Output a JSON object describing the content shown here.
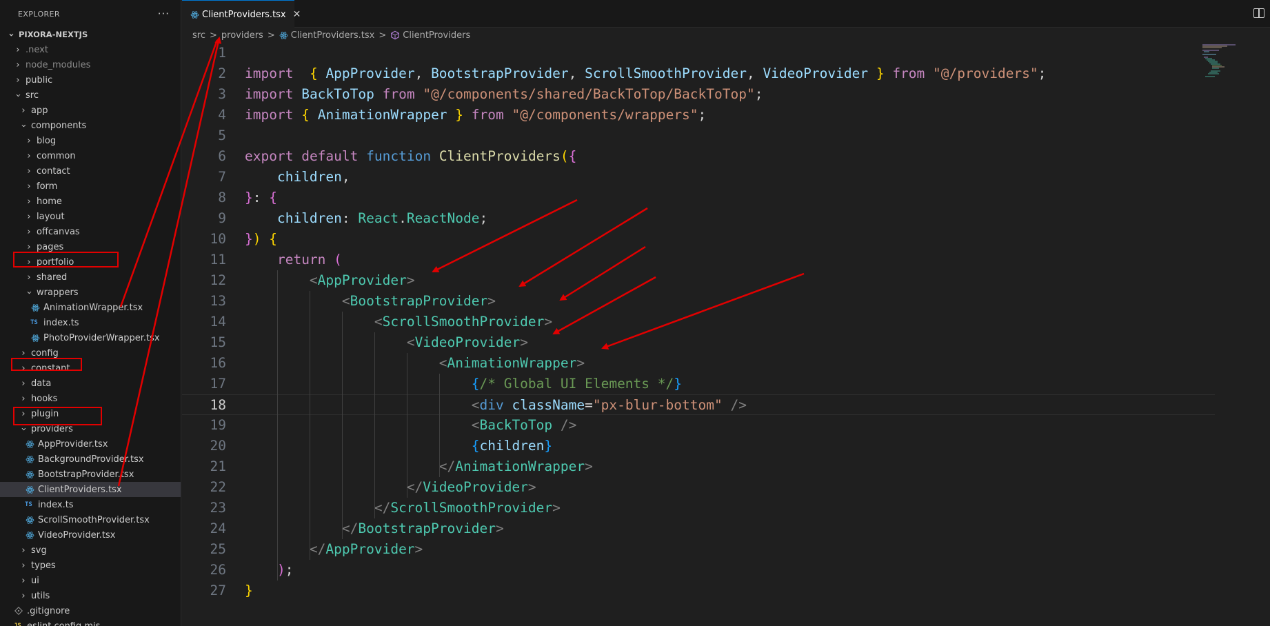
{
  "explorer": {
    "title": "EXPLORER",
    "more": "···",
    "project": "PIXORA-NEXTJS",
    "tree": [
      {
        "label": ".next",
        "depth": 1,
        "kind": "folder",
        "open": false,
        "dim": true
      },
      {
        "label": "node_modules",
        "depth": 1,
        "kind": "folder",
        "open": false,
        "dim": true
      },
      {
        "label": "public",
        "depth": 1,
        "kind": "folder",
        "open": false
      },
      {
        "label": "src",
        "depth": 1,
        "kind": "folder",
        "open": true
      },
      {
        "label": "app",
        "depth": 2,
        "kind": "folder",
        "open": false
      },
      {
        "label": "components",
        "depth": 2,
        "kind": "folder",
        "open": true
      },
      {
        "label": "blog",
        "depth": 3,
        "kind": "folder",
        "open": false
      },
      {
        "label": "common",
        "depth": 3,
        "kind": "folder",
        "open": false
      },
      {
        "label": "contact",
        "depth": 3,
        "kind": "folder",
        "open": false
      },
      {
        "label": "form",
        "depth": 3,
        "kind": "folder",
        "open": false
      },
      {
        "label": "home",
        "depth": 3,
        "kind": "folder",
        "open": false
      },
      {
        "label": "layout",
        "depth": 3,
        "kind": "folder",
        "open": false
      },
      {
        "label": "offcanvas",
        "depth": 3,
        "kind": "folder",
        "open": false
      },
      {
        "label": "pages",
        "depth": 3,
        "kind": "folder",
        "open": false
      },
      {
        "label": "portfolio",
        "depth": 3,
        "kind": "folder",
        "open": false
      },
      {
        "label": "shared",
        "depth": 3,
        "kind": "folder",
        "open": false
      },
      {
        "label": "wrappers",
        "depth": 3,
        "kind": "folder",
        "open": true
      },
      {
        "label": "AnimationWrapper.tsx",
        "depth": 4,
        "kind": "react"
      },
      {
        "label": "index.ts",
        "depth": 4,
        "kind": "ts"
      },
      {
        "label": "PhotoProviderWrapper.tsx",
        "depth": 4,
        "kind": "react"
      },
      {
        "label": "config",
        "depth": 2,
        "kind": "folder",
        "open": false
      },
      {
        "label": "constant",
        "depth": 2,
        "kind": "folder",
        "open": false
      },
      {
        "label": "data",
        "depth": 2,
        "kind": "folder",
        "open": false
      },
      {
        "label": "hooks",
        "depth": 2,
        "kind": "folder",
        "open": false
      },
      {
        "label": "plugin",
        "depth": 2,
        "kind": "folder",
        "open": false
      },
      {
        "label": "providers",
        "depth": 2,
        "kind": "folder",
        "open": true
      },
      {
        "label": "AppProvider.tsx",
        "depth": 3,
        "kind": "react"
      },
      {
        "label": "BackgroundProvider.tsx",
        "depth": 3,
        "kind": "react"
      },
      {
        "label": "BootstrapProvider.tsx",
        "depth": 3,
        "kind": "react"
      },
      {
        "label": "ClientProviders.tsx",
        "depth": 3,
        "kind": "react",
        "selected": true
      },
      {
        "label": "index.ts",
        "depth": 3,
        "kind": "ts"
      },
      {
        "label": "ScrollSmoothProvider.tsx",
        "depth": 3,
        "kind": "react"
      },
      {
        "label": "VideoProvider.tsx",
        "depth": 3,
        "kind": "react"
      },
      {
        "label": "svg",
        "depth": 2,
        "kind": "folder",
        "open": false
      },
      {
        "label": "types",
        "depth": 2,
        "kind": "folder",
        "open": false
      },
      {
        "label": "ui",
        "depth": 2,
        "kind": "folder",
        "open": false
      },
      {
        "label": "utils",
        "depth": 2,
        "kind": "folder",
        "open": false
      },
      {
        "label": ".gitignore",
        "depth": 1,
        "kind": "git"
      },
      {
        "label": "eslint.config.mjs",
        "depth": 1,
        "kind": "js"
      }
    ]
  },
  "tab": {
    "label": "ClientProviders.tsx",
    "close": "✕"
  },
  "breadcrumb": {
    "parts": [
      "src",
      "providers",
      "ClientProviders.tsx",
      "ClientProviders"
    ],
    "sep": ">"
  },
  "editor": {
    "current_line": 18,
    "lines": [
      [],
      [
        [
          "kw",
          "import"
        ],
        [
          "",
          "  "
        ],
        [
          "b1",
          "{"
        ],
        [
          "",
          " "
        ],
        [
          "var",
          "AppProvider"
        ],
        [
          "",
          ", "
        ],
        [
          "var",
          "BootstrapProvider"
        ],
        [
          "",
          ", "
        ],
        [
          "var",
          "ScrollSmoothProvider"
        ],
        [
          "",
          ", "
        ],
        [
          "var",
          "VideoProvider"
        ],
        [
          "",
          " "
        ],
        [
          "b1",
          "}"
        ],
        [
          "",
          " "
        ],
        [
          "kw",
          "from"
        ],
        [
          "",
          " "
        ],
        [
          "str",
          "\"@/providers\""
        ],
        [
          "",
          ";"
        ]
      ],
      [
        [
          "kw",
          "import"
        ],
        [
          "",
          " "
        ],
        [
          "var",
          "BackToTop"
        ],
        [
          "",
          " "
        ],
        [
          "kw",
          "from"
        ],
        [
          "",
          " "
        ],
        [
          "str",
          "\"@/components/shared/BackToTop/BackToTop\""
        ],
        [
          "",
          ";"
        ]
      ],
      [
        [
          "kw",
          "import"
        ],
        [
          "",
          " "
        ],
        [
          "b1",
          "{"
        ],
        [
          "",
          " "
        ],
        [
          "var",
          "AnimationWrapper"
        ],
        [
          "",
          " "
        ],
        [
          "b1",
          "}"
        ],
        [
          "",
          " "
        ],
        [
          "kw",
          "from"
        ],
        [
          "",
          " "
        ],
        [
          "str",
          "\"@/components/wrappers\""
        ],
        [
          "",
          ";"
        ]
      ],
      [],
      [
        [
          "kw",
          "export"
        ],
        [
          "",
          " "
        ],
        [
          "kw",
          "default"
        ],
        [
          "",
          " "
        ],
        [
          "kw2",
          "function"
        ],
        [
          "",
          " "
        ],
        [
          "fn",
          "ClientProviders"
        ],
        [
          "b1",
          "("
        ],
        [
          "b2",
          "{"
        ]
      ],
      [
        [
          "",
          "    "
        ],
        [
          "var",
          "children"
        ],
        [
          "",
          ","
        ]
      ],
      [
        [
          "b2",
          "}"
        ],
        [
          "",
          ": "
        ],
        [
          "b2",
          "{"
        ]
      ],
      [
        [
          "",
          "    "
        ],
        [
          "var",
          "children"
        ],
        [
          "",
          ": "
        ],
        [
          "type",
          "React"
        ],
        [
          "",
          "."
        ],
        [
          "type",
          "ReactNode"
        ],
        [
          "",
          ";"
        ]
      ],
      [
        [
          "b2",
          "}"
        ],
        [
          "b1",
          ")"
        ],
        [
          "",
          " "
        ],
        [
          "b1",
          "{"
        ]
      ],
      [
        [
          "",
          "    "
        ],
        [
          "kw",
          "return"
        ],
        [
          "",
          " "
        ],
        [
          "b2",
          "("
        ]
      ],
      [
        [
          "",
          "        "
        ],
        [
          "punct",
          "<"
        ],
        [
          "tag",
          "AppProvider"
        ],
        [
          "punct",
          ">"
        ]
      ],
      [
        [
          "",
          "            "
        ],
        [
          "punct",
          "<"
        ],
        [
          "tag",
          "BootstrapProvider"
        ],
        [
          "punct",
          ">"
        ]
      ],
      [
        [
          "",
          "                "
        ],
        [
          "punct",
          "<"
        ],
        [
          "tag",
          "ScrollSmoothProvider"
        ],
        [
          "punct",
          ">"
        ]
      ],
      [
        [
          "",
          "                    "
        ],
        [
          "punct",
          "<"
        ],
        [
          "tag",
          "VideoProvider"
        ],
        [
          "punct",
          ">"
        ]
      ],
      [
        [
          "",
          "                        "
        ],
        [
          "punct",
          "<"
        ],
        [
          "tag",
          "AnimationWrapper"
        ],
        [
          "punct",
          ">"
        ]
      ],
      [
        [
          "",
          "                            "
        ],
        [
          "b3",
          "{"
        ],
        [
          "cmt",
          "/* Global UI Elements */"
        ],
        [
          "b3",
          "}"
        ]
      ],
      [
        [
          "",
          "                            "
        ],
        [
          "punct",
          "<"
        ],
        [
          "kw2",
          "div"
        ],
        [
          "",
          " "
        ],
        [
          "attr",
          "className"
        ],
        [
          "",
          "="
        ],
        [
          "str",
          "\"px-blur-bottom\""
        ],
        [
          "",
          " "
        ],
        [
          "punct",
          "/>"
        ]
      ],
      [
        [
          "",
          "                            "
        ],
        [
          "punct",
          "<"
        ],
        [
          "tag",
          "BackToTop"
        ],
        [
          "",
          " "
        ],
        [
          "punct",
          "/>"
        ]
      ],
      [
        [
          "",
          "                            "
        ],
        [
          "b3",
          "{"
        ],
        [
          "var",
          "children"
        ],
        [
          "b3",
          "}"
        ]
      ],
      [
        [
          "",
          "                        "
        ],
        [
          "punct",
          "</"
        ],
        [
          "tag",
          "AnimationWrapper"
        ],
        [
          "punct",
          ">"
        ]
      ],
      [
        [
          "",
          "                    "
        ],
        [
          "punct",
          "</"
        ],
        [
          "tag",
          "VideoProvider"
        ],
        [
          "punct",
          ">"
        ]
      ],
      [
        [
          "",
          "                "
        ],
        [
          "punct",
          "</"
        ],
        [
          "tag",
          "ScrollSmoothProvider"
        ],
        [
          "punct",
          ">"
        ]
      ],
      [
        [
          "",
          "            "
        ],
        [
          "punct",
          "</"
        ],
        [
          "tag",
          "BootstrapProvider"
        ],
        [
          "punct",
          ">"
        ]
      ],
      [
        [
          "",
          "        "
        ],
        [
          "punct",
          "</"
        ],
        [
          "tag",
          "AppProvider"
        ],
        [
          "punct",
          ">"
        ]
      ],
      [
        [
          "",
          "    "
        ],
        [
          "b2",
          ")"
        ],
        [
          "",
          ";"
        ]
      ],
      [
        [
          "b1",
          "}"
        ]
      ]
    ]
  },
  "colors": {
    "accent": "#0078d4",
    "annotation_red": "#e20000",
    "react_icon": "#4fa7d9",
    "folder_chevron": "#c5c5c5"
  }
}
